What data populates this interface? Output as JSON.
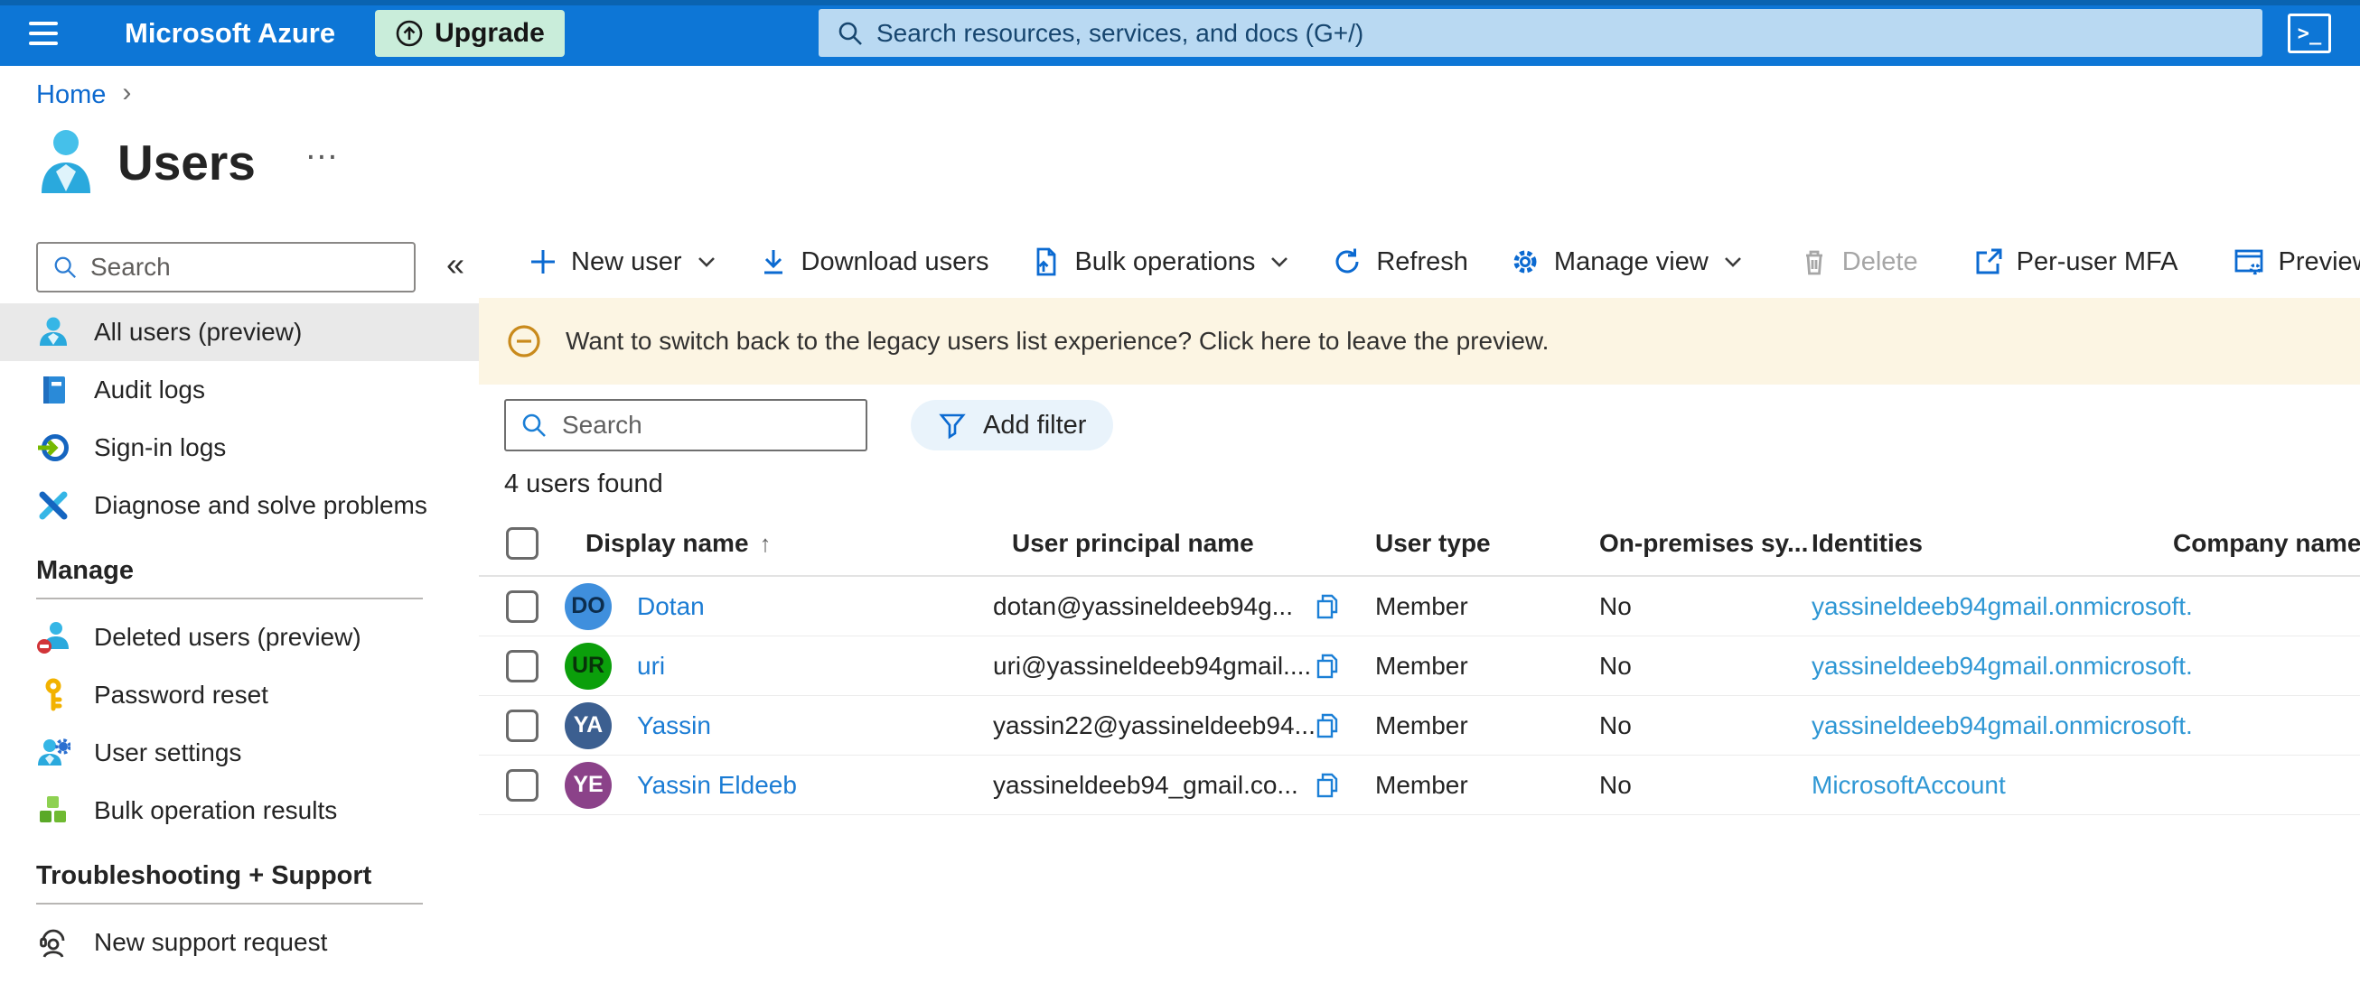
{
  "topbar": {
    "brand": "Microsoft Azure",
    "upgrade_label": "Upgrade",
    "search_placeholder": "Search resources, services, and docs (G+/)",
    "cloudshell_glyph": ">_"
  },
  "breadcrumb": {
    "home": "Home",
    "separator": "›"
  },
  "page": {
    "title": "Users",
    "overflow_glyph": "…"
  },
  "sidebar": {
    "search_placeholder": "Search",
    "collapse_glyph": "«",
    "items": [
      {
        "label": "All users (preview)"
      },
      {
        "label": "Audit logs"
      },
      {
        "label": "Sign-in logs"
      },
      {
        "label": "Diagnose and solve problems"
      }
    ],
    "sections": [
      {
        "header": "Manage",
        "items": [
          "Deleted users (preview)",
          "Password reset",
          "User settings",
          "Bulk operation results"
        ]
      },
      {
        "header": "Troubleshooting + Support",
        "items": [
          "New support request"
        ]
      }
    ]
  },
  "toolbar": {
    "new_user": "New user",
    "download_users": "Download users",
    "bulk_operations": "Bulk operations",
    "refresh": "Refresh",
    "manage_view": "Manage view",
    "delete": "Delete",
    "per_user_mfa": "Per-user MFA",
    "preview_features": "Preview features"
  },
  "banner": {
    "text": "Want to switch back to the legacy users list experience? Click here to leave the preview."
  },
  "filters": {
    "search_placeholder": "Search",
    "add_filter": "Add filter",
    "result_count": "4 users found"
  },
  "table": {
    "columns": {
      "display_name": "Display name",
      "sort_glyph": "↑",
      "upn": "User principal name",
      "user_type": "User type",
      "on_premises": "On-premises sy...",
      "identities": "Identities",
      "company": "Company name"
    },
    "rows": [
      {
        "initials": "DO",
        "avatar_style": "background:#3f8fdd;color:#0c2d4d",
        "display_name": "Dotan",
        "upn": "dotan@yassineldeeb94g...",
        "user_type": "Member",
        "on_premises": "No",
        "identities": "yassineldeeb94gmail.onmicrosoft."
      },
      {
        "initials": "UR",
        "avatar_style": "background:#0b9f0b;color:#08320a",
        "display_name": "uri",
        "upn": "uri@yassineldeeb94gmail....",
        "user_type": "Member",
        "on_premises": "No",
        "identities": "yassineldeeb94gmail.onmicrosoft."
      },
      {
        "initials": "YA",
        "avatar_style": "background:#3c5f90;color:#ffffff",
        "display_name": "Yassin",
        "upn": "yassin22@yassineldeeb94...",
        "user_type": "Member",
        "on_premises": "No",
        "identities": "yassineldeeb94gmail.onmicrosoft."
      },
      {
        "initials": "YE",
        "avatar_style": "background:#8b4289;color:#ffffff",
        "display_name": "Yassin Eldeeb",
        "upn": "yassineldeeb94_gmail.co...",
        "user_type": "Member",
        "on_premises": "No",
        "identities": "MicrosoftAccount"
      }
    ]
  },
  "colors": {
    "topbar_blue": "#0d76d6",
    "upgrade_green": "#c9edda",
    "banner_cream": "#fcf5e3",
    "selected_gray": "#e9e9e9",
    "link_blue": "#1b7cd4",
    "identities_blue": "#2f97d4"
  }
}
